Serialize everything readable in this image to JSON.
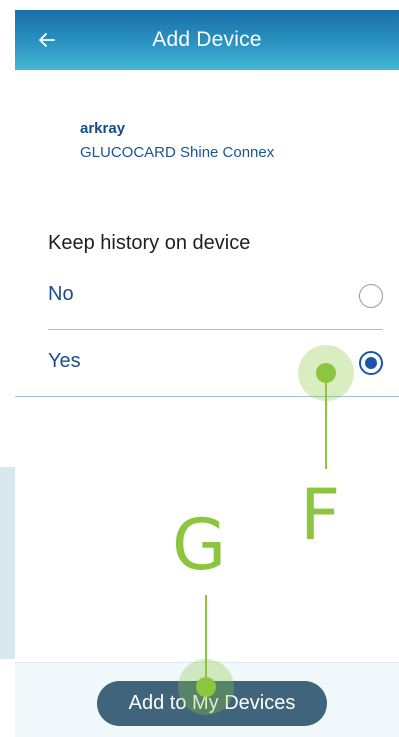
{
  "app_bar": {
    "title": "Add Device",
    "back_icon": "arrow-left-icon"
  },
  "device": {
    "brand": "arkray",
    "model": "GLUCOCARD Shine Connex"
  },
  "history": {
    "title": "Keep history on device",
    "options": [
      {
        "label": "No",
        "selected": false
      },
      {
        "label": "Yes",
        "selected": true
      }
    ]
  },
  "footer": {
    "primary_button_label": "Add to My Devices"
  },
  "annotations": {
    "f_label": "F",
    "g_label": "G",
    "color": "#8cc63f"
  },
  "colors": {
    "brand_text": "#184c86",
    "radio_selected": "#1a56a8",
    "button_bg": "#3f647c",
    "app_bar_gradient_top": "#1b6fa8",
    "app_bar_gradient_bottom": "#44b8d3"
  }
}
